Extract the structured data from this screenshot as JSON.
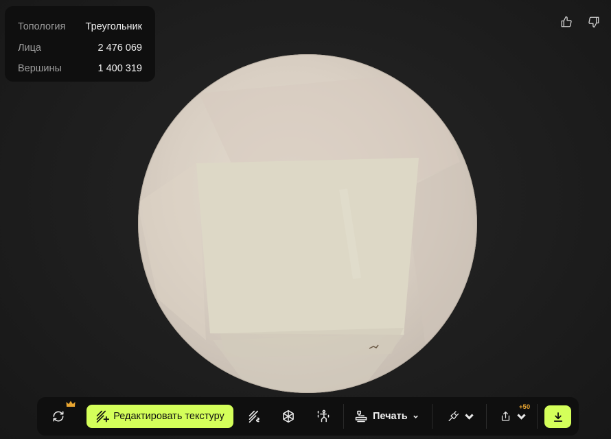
{
  "stats": {
    "topology_label": "Топология",
    "topology_value": "Треугольник",
    "faces_label": "Лица",
    "faces_value": "2 476 069",
    "vertices_label": "Вершины",
    "vertices_value": "1 400 319"
  },
  "feedback": {
    "like_icon": "thumbs-up-icon",
    "dislike_icon": "thumbs-down-icon"
  },
  "toolbar": {
    "regenerate_icon": "refresh-icon",
    "premium_icon": "crown-icon",
    "edit_texture_label": "Редактировать текстуру",
    "print_label": "Печать",
    "share_badge": "+50",
    "download_icon": "download-icon"
  },
  "colors": {
    "accent": "#d4ff5a",
    "badge": "#e8a531",
    "panel": "#0f0f0f",
    "background": "#1e1e1e",
    "model": "#ddd3c7"
  }
}
